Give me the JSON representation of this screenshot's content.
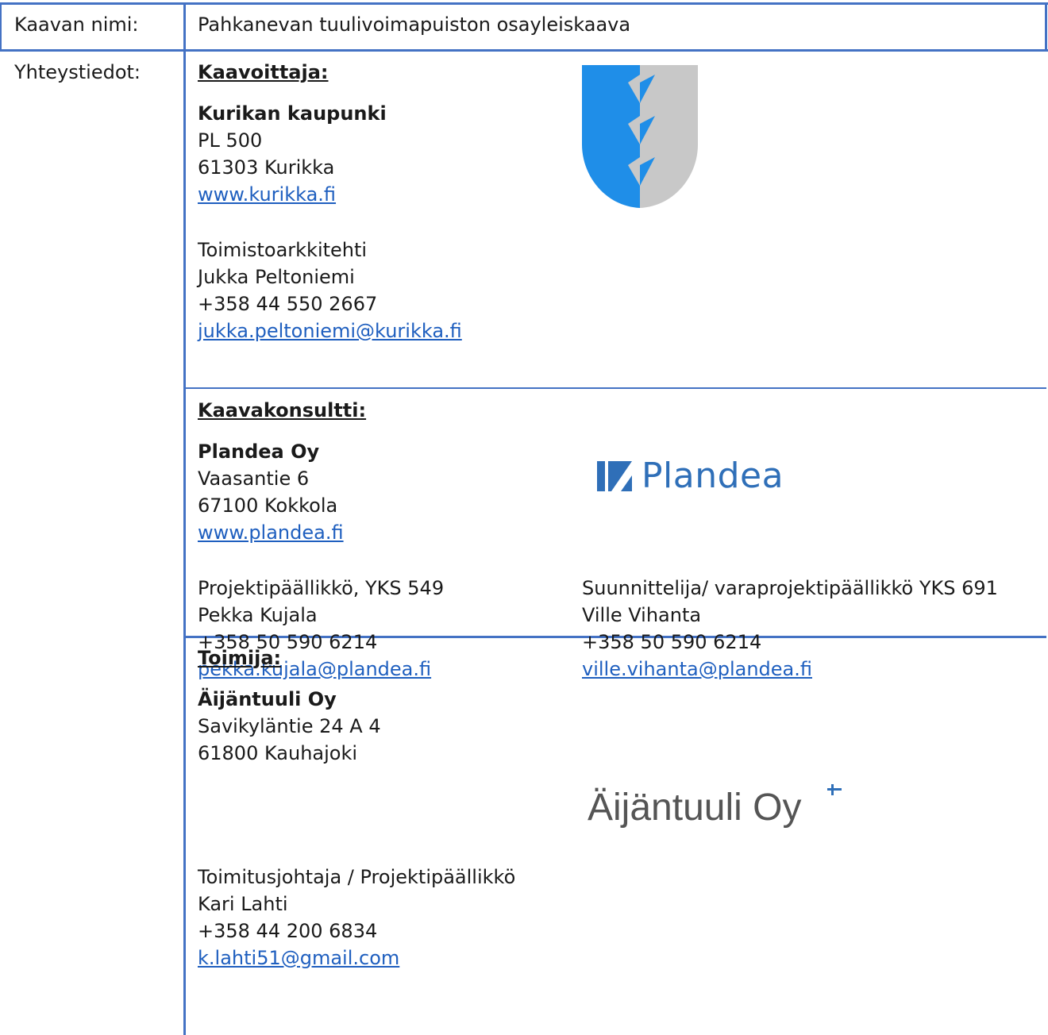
{
  "header": {
    "name_label": "Kaavan nimi:",
    "name_value": "Pahkanevan tuulivoimapuiston osayleiskaava",
    "contact_label": "Yhteystiedot:"
  },
  "kaavoittaja": {
    "heading": "Kaavoittaja:",
    "org": "Kurikan kaupunki",
    "address1": "PL 500",
    "address2": "61303 Kurikka",
    "web": "www.kurikka.fi",
    "person_title": "Toimistoarkkitehti",
    "person_name": "Jukka Peltoniemi",
    "person_phone": "+358 44 550 2667",
    "person_email": "jukka.peltoniemi@kurikka.fi"
  },
  "kaavakonsultti": {
    "heading": "Kaavakonsultti:",
    "org": "Plandea Oy",
    "address1": "Vaasantie 6",
    "address2": "67100 Kokkola",
    "web": "www.plandea.fi",
    "logo_text": "Plandea",
    "person1": {
      "title": "Projektipäällikkö, YKS 549",
      "name": "Pekka Kujala",
      "phone": "+358 50 590 6214",
      "email": "pekka.kujala@plandea.fi"
    },
    "person2": {
      "title": "Suunnittelija/ varaprojektipäällikkö YKS 691",
      "name": "Ville Vihanta",
      "phone": "+358 50 590 6214",
      "email": "ville.vihanta@plandea.fi"
    }
  },
  "toimija": {
    "heading": "Toimija:",
    "org": "Äijäntuuli Oy",
    "address1": "Savikyläntie 24 A 4",
    "address2": "61800 Kauhajoki",
    "logo_text": "Äijäntuuli Oy",
    "person_title": "Toimitusjohtaja / Projektipäällikkö",
    "person_name": "Kari Lahti",
    "person_phone": "+358 44 200 6834",
    "person_email": "k.lahti51@gmail.com"
  },
  "colors": {
    "border": "#4472c4",
    "link": "#1f5fbf",
    "crest_blue": "#1f8ee8",
    "crest_grey": "#c8c8c8",
    "plandea_blue": "#2f6fb8"
  }
}
